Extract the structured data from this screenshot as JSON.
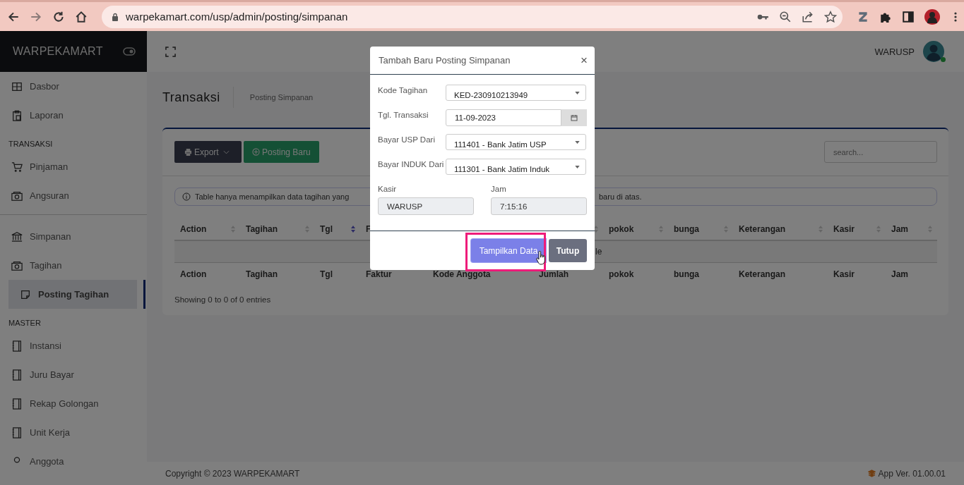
{
  "browser": {
    "url": "warpekamart.com/usp/admin/posting/simpanan"
  },
  "sidebar": {
    "brand": "WARPEKAMART",
    "groups": [
      {
        "items": [
          {
            "label": "Dasbor",
            "selected": false
          },
          {
            "label": "Laporan",
            "selected": false
          }
        ]
      },
      {
        "heading": "TRANSAKSI",
        "items": [
          {
            "label": "Pinjaman",
            "selected": false
          },
          {
            "label": "Angsuran",
            "selected": false
          }
        ]
      },
      {
        "items": [
          {
            "label": "Simpanan",
            "selected": false
          },
          {
            "label": "Tagihan",
            "selected": false,
            "children": [
              {
                "label": "Posting Tagihan",
                "selected": true
              }
            ]
          }
        ]
      },
      {
        "heading": "MASTER",
        "items": [
          {
            "label": "Instansi",
            "selected": false
          },
          {
            "label": "Juru Bayar",
            "selected": false
          },
          {
            "label": "Rekap Golongan",
            "selected": false
          },
          {
            "label": "Unit Kerja",
            "selected": false
          },
          {
            "label": "Anggota",
            "selected": false
          }
        ]
      }
    ]
  },
  "header": {
    "user": "WARUSP"
  },
  "page": {
    "title": "Transaksi",
    "breadcrumb": "Posting Simpanan"
  },
  "toolbar": {
    "buttons": [
      {
        "label": "Export",
        "kind": "dropdown"
      },
      {
        "label": "Posting Baru",
        "kind": "add"
      }
    ],
    "search": {
      "placeholder": "search..."
    }
  },
  "notice": {
    "parts": [
      "Table hanya menampilkan data tagihan yang",
      "baru di atas."
    ]
  },
  "table": {
    "header": [
      {
        "label": "Action",
        "sorted": false
      },
      {
        "label": "Tagihan",
        "sorted": false
      },
      {
        "label": "Tgl",
        "sorted": true
      },
      {
        "label": "F",
        "sorted": false
      },
      {
        "label": "pokok",
        "sorted": false
      },
      {
        "label": "bunga",
        "sorted": false
      },
      {
        "label": "Keterangan",
        "sorted": false
      },
      {
        "label": "Kasir",
        "sorted": false
      },
      {
        "label": "Jam",
        "sorted": false
      }
    ],
    "empty_text": "le",
    "footer": [
      "Action",
      "Tagihan",
      "Tgl",
      "Faktur",
      "Kode Anggota",
      "Jumlah",
      "pokok",
      "bunga",
      "Keterangan",
      "Kasir",
      "Jam"
    ],
    "info": "Showing 0 to 0 of 0 entries"
  },
  "footer": {
    "copyright": "Copyright © 2023 WARPEKAMART",
    "version": "App Ver. 01.00.01"
  },
  "modal": {
    "title": "Tambah Baru Posting Simpanan",
    "close": "×",
    "fields": [
      {
        "label": "Kode Tagihan",
        "kind": "select",
        "value": "KED-230910213949"
      },
      {
        "label": "Tgl. Transaksi",
        "kind": "date",
        "value": "11-09-2023"
      },
      {
        "label": "Bayar USP Dari",
        "kind": "select",
        "value": "111401 - Bank Jatim USP"
      },
      {
        "label": "Bayar INDUK Dari",
        "kind": "select",
        "value": "111301 - Bank Jatim Induk"
      }
    ],
    "readonly_fields": [
      {
        "label": "Kasir",
        "value": "WARUSP"
      },
      {
        "label": "Jam",
        "value": "7:15:16"
      }
    ],
    "buttons": [
      {
        "label": "Tampilkan Data",
        "kind": "primary",
        "highlighted": true
      },
      {
        "label": "Tutup",
        "kind": "secondary",
        "highlighted": false
      }
    ]
  }
}
